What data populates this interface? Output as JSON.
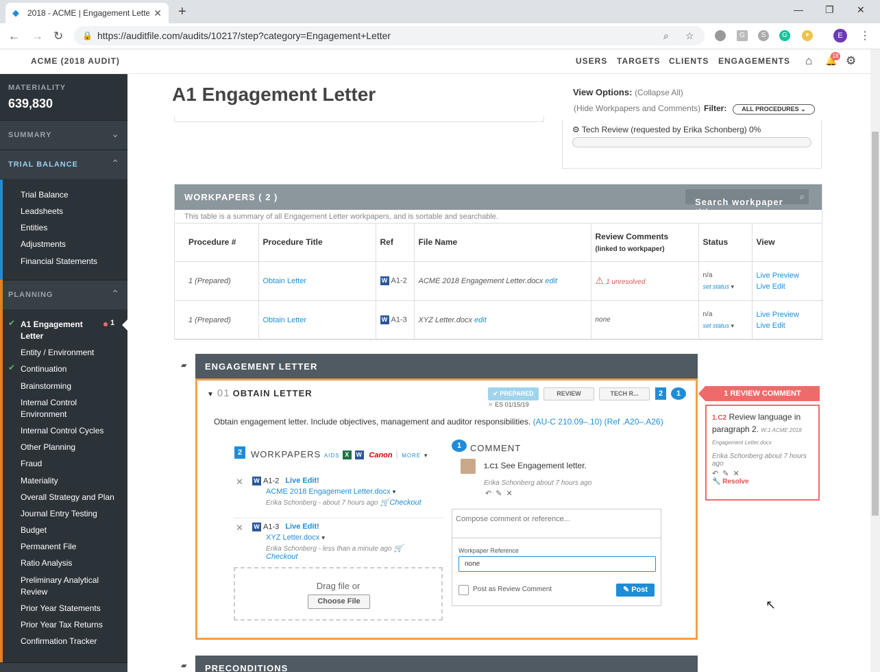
{
  "browser": {
    "tab_title": "2018 - ACME | Engagement Lette",
    "url": "https://auditfile.com/audits/10217/step?category=Engagement+Letter",
    "profile_initial": "E"
  },
  "header": {
    "brand": "ACME (2018 AUDIT)",
    "nav": [
      "USERS",
      "TARGETS",
      "CLIENTS",
      "ENGAGEMENTS"
    ],
    "notif_count": "18"
  },
  "sidebar": {
    "materiality_label": "MATERIALITY",
    "materiality_value": "639,830",
    "summary_label": "SUMMARY",
    "trial_balance_label": "TRIAL BALANCE",
    "trial_balance_items": [
      "Trial Balance",
      "Leadsheets",
      "Entities",
      "Adjustments",
      "Financial Statements"
    ],
    "planning_label": "PLANNING",
    "planning_items": [
      {
        "label": "A1 Engagement Letter",
        "checked": true,
        "active": true,
        "badge": "1"
      },
      {
        "label": "Entity / Environment",
        "checked": false
      },
      {
        "label": "Continuation",
        "checked": true
      },
      {
        "label": "Brainstorming",
        "checked": false
      },
      {
        "label": "Internal Control Environment",
        "checked": false
      },
      {
        "label": "Internal Control Cycles",
        "checked": false
      },
      {
        "label": "Other Planning",
        "checked": false
      },
      {
        "label": "Fraud",
        "checked": false
      },
      {
        "label": "Materiality",
        "checked": false
      },
      {
        "label": "Overall Strategy and Plan",
        "checked": false
      },
      {
        "label": "Journal Entry Testing",
        "checked": false
      },
      {
        "label": "Budget",
        "checked": false
      },
      {
        "label": "Permanent File",
        "checked": false
      },
      {
        "label": "Ratio Analysis",
        "checked": false
      },
      {
        "label": "Preliminary Analytical Review",
        "checked": false
      },
      {
        "label": "Prior Year Statements",
        "checked": false
      },
      {
        "label": "Prior Year Tax Returns",
        "checked": false
      },
      {
        "label": "Confirmation Tracker",
        "checked": false
      }
    ]
  },
  "page": {
    "title": "A1 Engagement Letter",
    "view_options": "View Options:",
    "collapse_all": "(Collapse All)",
    "hide_workpapers": "(Hide Workpapers and Comments)",
    "filter_label": "Filter:",
    "filter_value": "ALL PROCEDURES",
    "tech_review": "Tech Review (requested by Erika Schonberg) 0%"
  },
  "workpapers": {
    "title": "WORKPAPERS ( 2 )",
    "search_placeholder": "Search workpaper titles",
    "summary": "This table is a summary of all Engagement Letter workpapers, and is sortable and searchable.",
    "columns": [
      "Procedure #",
      "Procedure Title",
      "Ref",
      "File Name",
      "Review Comments",
      "Status",
      "View"
    ],
    "review_sub": "(linked to workpaper)",
    "rows": [
      {
        "proc": "1 (Prepared)",
        "title": "Obtain Letter",
        "ref": "A1-2",
        "file": "ACME 2018 Engagement Letter.docx",
        "edit": "edit",
        "review": "1 unresolved",
        "status": "n/a",
        "set_status": "set status",
        "preview": "Live Preview",
        "live_edit": "Live Edit"
      },
      {
        "proc": "1 (Prepared)",
        "title": "Obtain Letter",
        "ref": "A1-3",
        "file": "XYZ Letter.docx",
        "edit": "edit",
        "review": "none",
        "status": "n/a",
        "set_status": "set status",
        "preview": "Live Preview",
        "live_edit": "Live Edit"
      }
    ]
  },
  "engagement": {
    "section_title": "ENGAGEMENT LETTER",
    "proc_num": "01",
    "proc_title": "OBTAIN LETTER",
    "prepared": "PREPARED",
    "review": "REVIEW",
    "tech_review": "TECH R...",
    "wp_count": "2",
    "comment_count": "1",
    "signoff": "ES 01/15/19",
    "description": "Obtain engagement letter. Include objectives, management and auditor responsibilities.",
    "refs": "(AU-C 210.09–.10) (Ref .A20–.A26)",
    "wp_label": "WORKPAPERS",
    "aids": "AIDS",
    "canon": "Canon",
    "more": "MORE",
    "wp_items": [
      {
        "ref": "A1-2",
        "live": "Live Edit!",
        "file": "ACME 2018 Engagement Letter.docx",
        "meta": "Erika Schonberg - about 7 hours ago",
        "checkout": "Checkout"
      },
      {
        "ref": "A1-3",
        "live": "Live Edit!",
        "file": "XYZ Letter.docx",
        "meta": "Erika Schonberg - less than a minute ago",
        "checkout": "Checkout"
      }
    ],
    "drag": "Drag file or",
    "choose": "Choose File",
    "comment_label": "COMMENT",
    "comment_id": "1.C1",
    "comment_text": "See Engagement letter.",
    "comment_meta": "Erika Schonberg about 7 hours ago",
    "compose_placeholder": "Compose comment or reference...",
    "wref_label": "Workpaper Reference",
    "wref_value": "none",
    "post_review": "Post as Review Comment",
    "post": "Post"
  },
  "review_comment": {
    "header": "1 REVIEW COMMENT",
    "id": "1.C2",
    "text": "Review language in paragraph 2.",
    "ref": "W:1 ACME 2018 Engagement Letter.docx",
    "meta": "Erika Schonberg about 7 hours ago",
    "resolve": "Resolve"
  },
  "next_section": "PRECONDITIONS",
  "colors": {
    "accent": "#1f8dd6",
    "sidebar": "#2c3338",
    "highlight": "#f0a04b",
    "alert": "#ef6b6b"
  }
}
